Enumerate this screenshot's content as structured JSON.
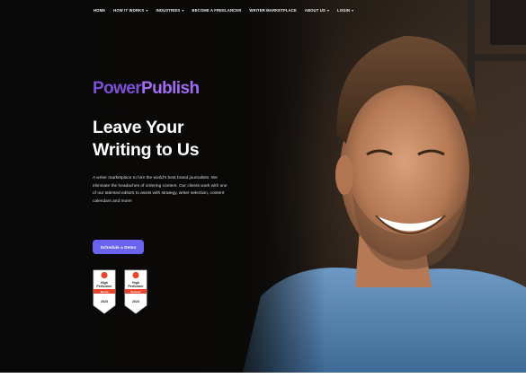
{
  "nav": {
    "items": [
      {
        "label": "Home",
        "caret": false
      },
      {
        "label": "How it Works",
        "caret": true
      },
      {
        "label": "Industries",
        "caret": true
      },
      {
        "label": "Become a Freelancer",
        "caret": false
      },
      {
        "label": "Writer Marketplace",
        "caret": false
      },
      {
        "label": "About Us",
        "caret": true
      },
      {
        "label": "Login",
        "caret": true
      }
    ]
  },
  "hero": {
    "brand_part1": "Power",
    "brand_part2": "Publish",
    "headline_line1": "Leave Your",
    "headline_line2": "Writing to Us",
    "body": "A writer marketplace to hire the world's best brand journalists. We eliminate the headaches of ordering content. Our clients work with one of our talented editors to assist with strategy, writer selection, content calendars and more!",
    "cta_label": "Schedule a Demo"
  },
  "badges": [
    {
      "title": "High Performer",
      "subtitle": "Spring",
      "year": "2023"
    },
    {
      "title": "High Performer",
      "subtitle": "Summer",
      "year": "2023"
    }
  ],
  "colors": {
    "brand_dark": "#7b4fd6",
    "brand_light": "#a26cf2",
    "cta_bg": "#6b63f0",
    "badge_red": "#e8442e"
  }
}
